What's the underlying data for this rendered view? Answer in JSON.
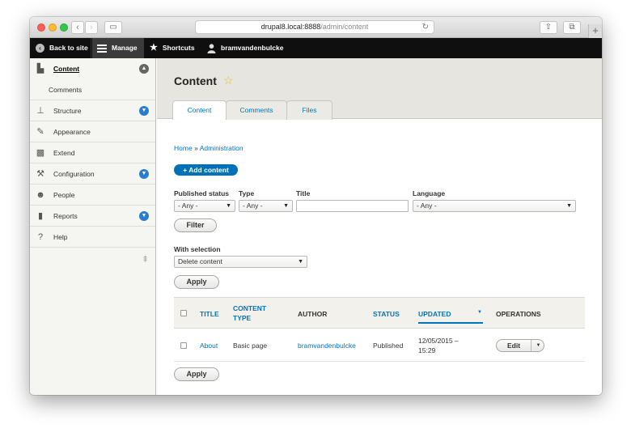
{
  "browser": {
    "url_host": "drupal8.local:8888",
    "url_path": "/admin/content"
  },
  "toolbar": {
    "back_label": "Back to site",
    "manage_label": "Manage",
    "shortcuts_label": "Shortcuts",
    "user_label": "bramvandenbulcke"
  },
  "sidebar": {
    "items": [
      {
        "label": "Content",
        "icon": "document-icon"
      },
      {
        "label": "Comments",
        "icon": ""
      },
      {
        "label": "Structure",
        "icon": "sitemap-icon"
      },
      {
        "label": "Appearance",
        "icon": "paintbrush-icon"
      },
      {
        "label": "Extend",
        "icon": "puzzle-icon"
      },
      {
        "label": "Configuration",
        "icon": "wrench-icon"
      },
      {
        "label": "People",
        "icon": "people-icon"
      },
      {
        "label": "Reports",
        "icon": "bar-chart-icon"
      },
      {
        "label": "Help",
        "icon": "help-icon"
      }
    ]
  },
  "page": {
    "title": "Content",
    "tabs": [
      "Content",
      "Comments",
      "Files"
    ],
    "breadcrumb": [
      "Home",
      "Administration"
    ],
    "breadcrumb_sep": "»",
    "add_button": "+ Add content"
  },
  "filters": {
    "published_label": "Published status",
    "published_value": "- Any -",
    "type_label": "Type",
    "type_value": "- Any -",
    "title_label": "Title",
    "title_value": "",
    "language_label": "Language",
    "language_value": "- Any -",
    "filter_button": "Filter"
  },
  "bulk": {
    "label": "With selection",
    "value": "Delete content",
    "apply_button": "Apply"
  },
  "table": {
    "headers": [
      "TITLE",
      "CONTENT",
      "TYPE",
      "AUTHOR",
      "STATUS",
      "UPDATED",
      "OPERATIONS"
    ],
    "rows": [
      {
        "title": "About",
        "content_type": "Basic page",
        "author": "bramvandenbulcke",
        "status": "Published",
        "updated_date": "12/05/2015 –",
        "updated_time": "15:29",
        "operation": "Edit"
      }
    ]
  },
  "bottom_apply": "Apply",
  "colors": {
    "link": "#0074bd",
    "primary_button": "#0071b8",
    "toolbar_bg": "#0f0f0f",
    "header_band": "#e6e5e0"
  }
}
